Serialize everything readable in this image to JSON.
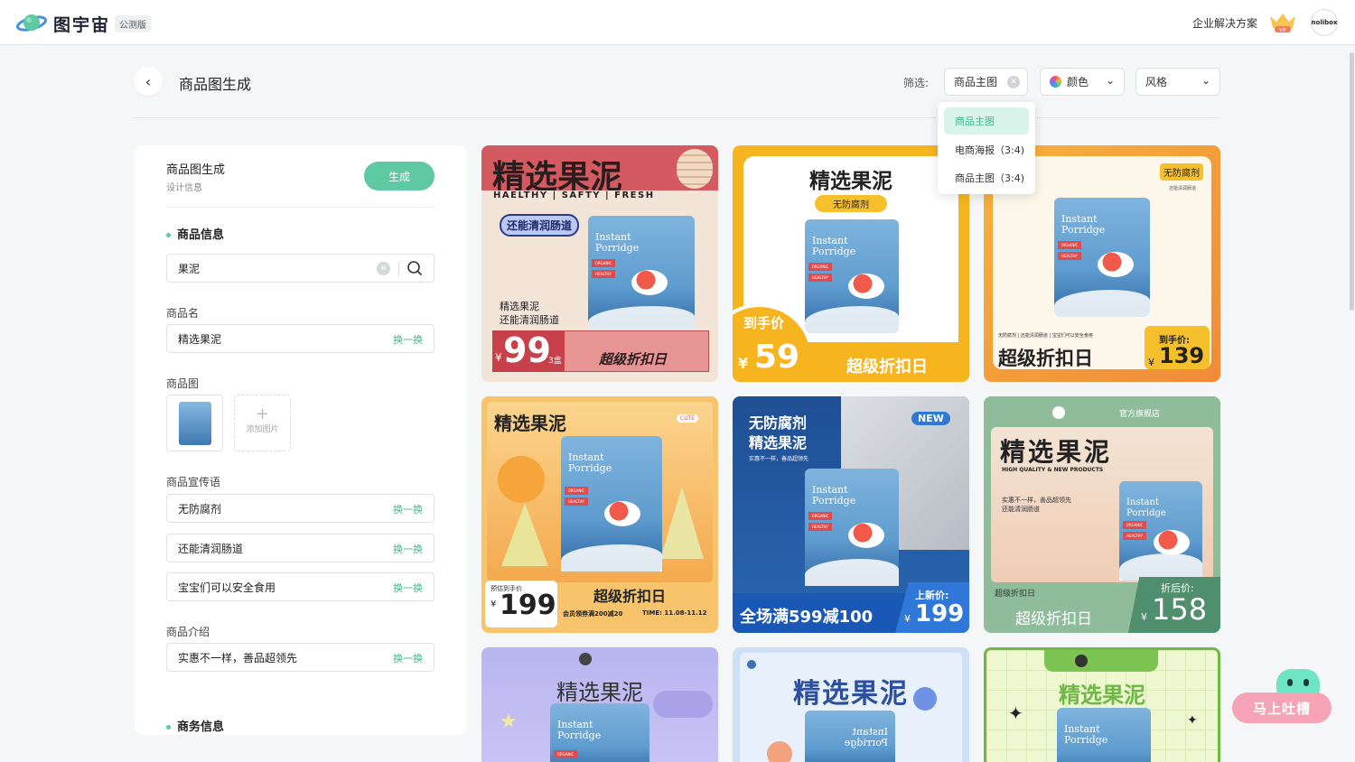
{
  "header": {
    "logo_text": "图宇宙",
    "beta_badge": "公测版",
    "enterprise_link": "企业解决方案",
    "vip_label": "VIP",
    "avatar_text": "nolibox"
  },
  "page": {
    "title": "商品图生成"
  },
  "filters": {
    "label": "筛选:",
    "type_value": "商品主图",
    "color_label": "颜色",
    "style_label": "风格",
    "type_options": [
      "商品主图",
      "电商海报（3:4)",
      "商品主图（3:4)"
    ]
  },
  "panel": {
    "title": "商品图生成",
    "subtitle": "设计信息",
    "generate_button": "生成",
    "section_product": "商品信息",
    "search_value": "果泥",
    "name_label": "商品名",
    "name_value": "精选果泥",
    "swap": "换一换",
    "image_label": "商品图",
    "add_image": "添加图片",
    "slogan_label": "商品宣传语",
    "slogans": [
      "无防腐剂",
      "还能清润肠道",
      "宝宝们可以安全食用"
    ],
    "intro_label": "商品介绍",
    "intro_value": "实惠不一样，善品超领先",
    "section_business": "商务信息"
  },
  "bag": {
    "line1": "Instant",
    "line2": "Porridge",
    "tag1": "ORGANIC",
    "tag2": "HEALTHY"
  },
  "cards": {
    "c1": {
      "title": "精选果泥",
      "tagline": "HAELTHY | SAFTY | FRESH",
      "badge": "还能清润肠道",
      "desc1": "精选果泥",
      "desc2": "还能清润肠道",
      "price": "99",
      "yen": "¥",
      "unit": "3盒",
      "promo": "超级折扣日"
    },
    "c2": {
      "title": "精选果泥",
      "badge": "无防腐剂",
      "price_label": "到手价",
      "yen": "¥",
      "price": "59",
      "promo": "超级折扣日"
    },
    "c3": {
      "badge": "无防腐剂",
      "sub": "还能清润肠道",
      "small": "无防腐剂 | 还能清润肠道 | 宝宝们可以安全食用",
      "promo": "超级折扣日",
      "price_label": "到手价:",
      "yen": "¥",
      "price": "139"
    },
    "c4": {
      "title": "精选果泥",
      "cute": "CUTE",
      "pre_label": "预估到手价",
      "yen": "¥",
      "price": "199",
      "promo": "超级折扣日",
      "coupon": "会员领券满200减20",
      "time": "TIME: 11.08-11.12"
    },
    "c5": {
      "title1": "无防腐剂",
      "title2": "精选果泥",
      "new": "NEW",
      "sub": "实惠不一样，善品超领先",
      "promo": "全场满599减100",
      "price_label": "上新价:",
      "yen": "¥",
      "price": "199"
    },
    "c6": {
      "store": "官方旗舰店",
      "title": "精选果泥",
      "eng": "HIGH QUALITY & NEW PRODUCTS",
      "sub1": "实惠不一样，善品超领先",
      "sub2": "还能清润肠道",
      "promo_small": "超级折扣日",
      "promo": "超级折扣日",
      "price_label": "折后价:",
      "yen": "¥",
      "price": "158"
    },
    "c7": {
      "title": "精选果泥"
    },
    "c8": {
      "title": "精选果泥"
    },
    "c9": {
      "title": "精选果泥"
    }
  },
  "feedback": {
    "label": "马上吐槽"
  }
}
